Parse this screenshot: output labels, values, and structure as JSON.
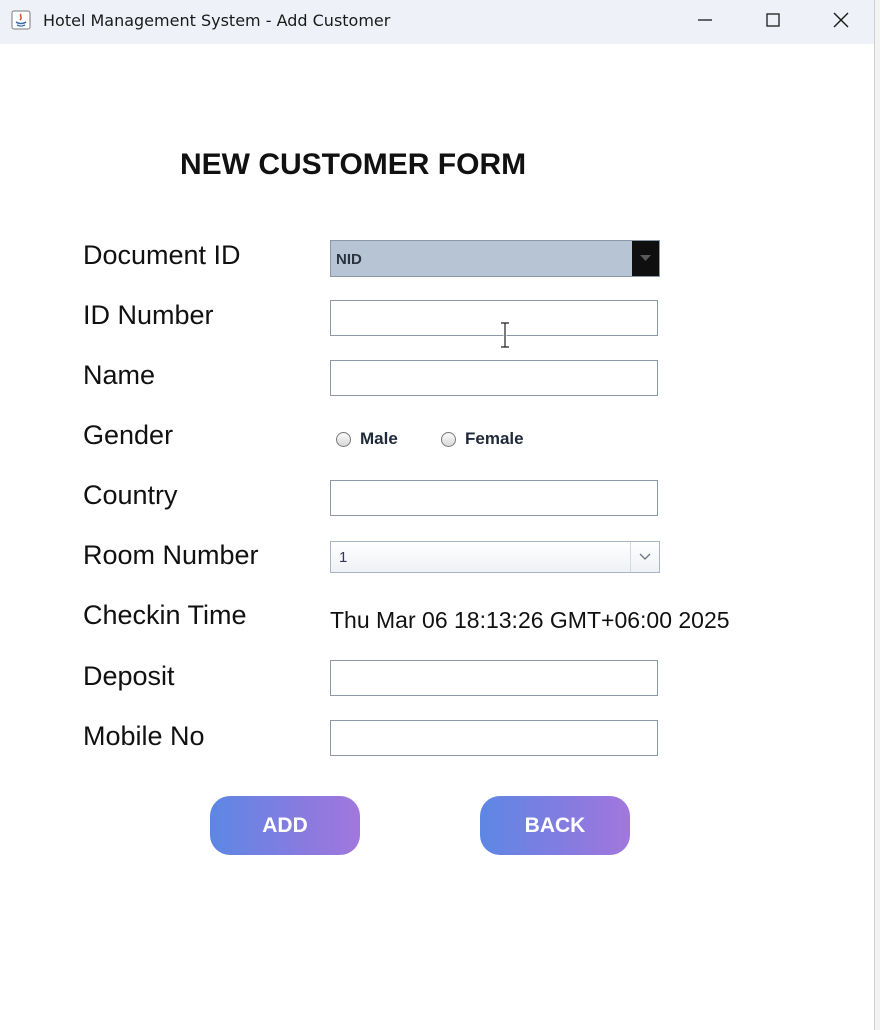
{
  "window": {
    "title": "Hotel Management System - Add Customer",
    "controls": {
      "minimize_icon": "minimize-icon",
      "maximize_icon": "maximize-icon",
      "close_icon": "close-icon"
    }
  },
  "form": {
    "heading": "NEW CUSTOMER FORM",
    "fields": {
      "document_id": {
        "label": "Document ID",
        "value": "NID"
      },
      "id_number": {
        "label": "ID Number",
        "value": "",
        "placeholder": ""
      },
      "name": {
        "label": "Name",
        "value": "",
        "placeholder": ""
      },
      "gender": {
        "label": "Gender",
        "options": {
          "male": "Male",
          "female": "Female"
        },
        "selected": null
      },
      "country": {
        "label": "Country",
        "value": "",
        "placeholder": ""
      },
      "room_number": {
        "label": "Room Number",
        "value": "1"
      },
      "checkin_time": {
        "label": "Checkin Time",
        "value": "Thu Mar 06 18:13:26 GMT+06:00 2025"
      },
      "deposit": {
        "label": "Deposit",
        "value": "",
        "placeholder": ""
      },
      "mobile_no": {
        "label": "Mobile No",
        "value": "",
        "placeholder": ""
      }
    },
    "buttons": {
      "add": "ADD",
      "back": "BACK"
    }
  },
  "colors": {
    "titlebar_bg": "#eef2f8",
    "document_select_bg": "#b6c4d4",
    "button_gradient_start": "#5d87e4",
    "button_gradient_end": "#a277dc"
  }
}
